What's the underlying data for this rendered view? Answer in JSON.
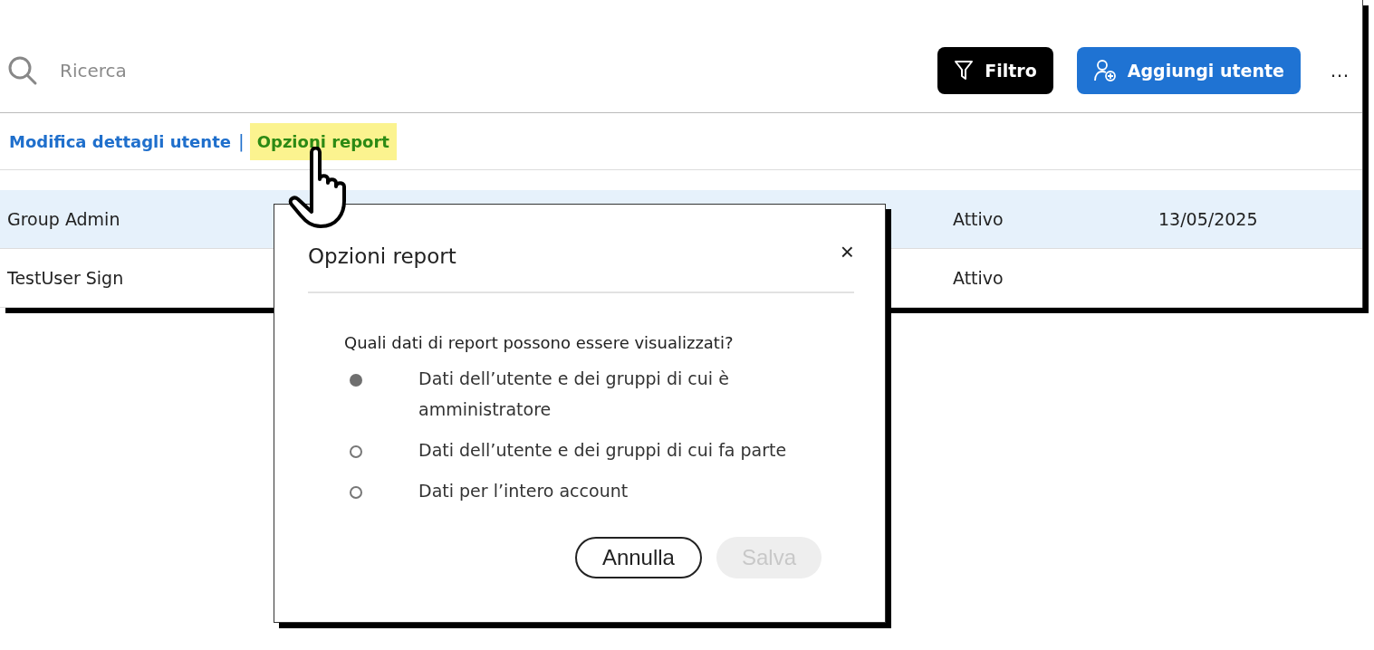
{
  "toolbar": {
    "search": {
      "placeholder": "Ricerca"
    },
    "buttons": [
      {
        "kind": "filter",
        "label": "Filtro"
      },
      {
        "kind": "add-user",
        "label": "Aggiungi utente"
      }
    ],
    "more": "…"
  },
  "actions": [
    {
      "label": "Modifica dettagli utente",
      "highlighted": false
    },
    {
      "label": "Opzioni report",
      "highlighted": true
    }
  ],
  "separator": "|",
  "table": {
    "rows": [
      {
        "name": "Group Admin",
        "status": "Attivo",
        "date": "13/05/2025",
        "selected": true
      },
      {
        "name": "TestUser Sign",
        "status": "Attivo",
        "selected": false
      }
    ]
  },
  "dialog": {
    "title": "Opzioni report",
    "close": "×",
    "question": "Quali dati di report possono essere visualizzati?",
    "options": [
      {
        "label": "Dati dell’utente e dei gruppi di cui è amministratore",
        "selected": true
      },
      {
        "label": "Dati dell’utente e dei gruppi di cui fa parte",
        "selected": false
      },
      {
        "label": "Dati per l’intero account",
        "selected": false
      }
    ],
    "buttons": [
      {
        "label": "Annulla",
        "disabled": false
      },
      {
        "label": "Salva",
        "disabled": true
      }
    ]
  }
}
